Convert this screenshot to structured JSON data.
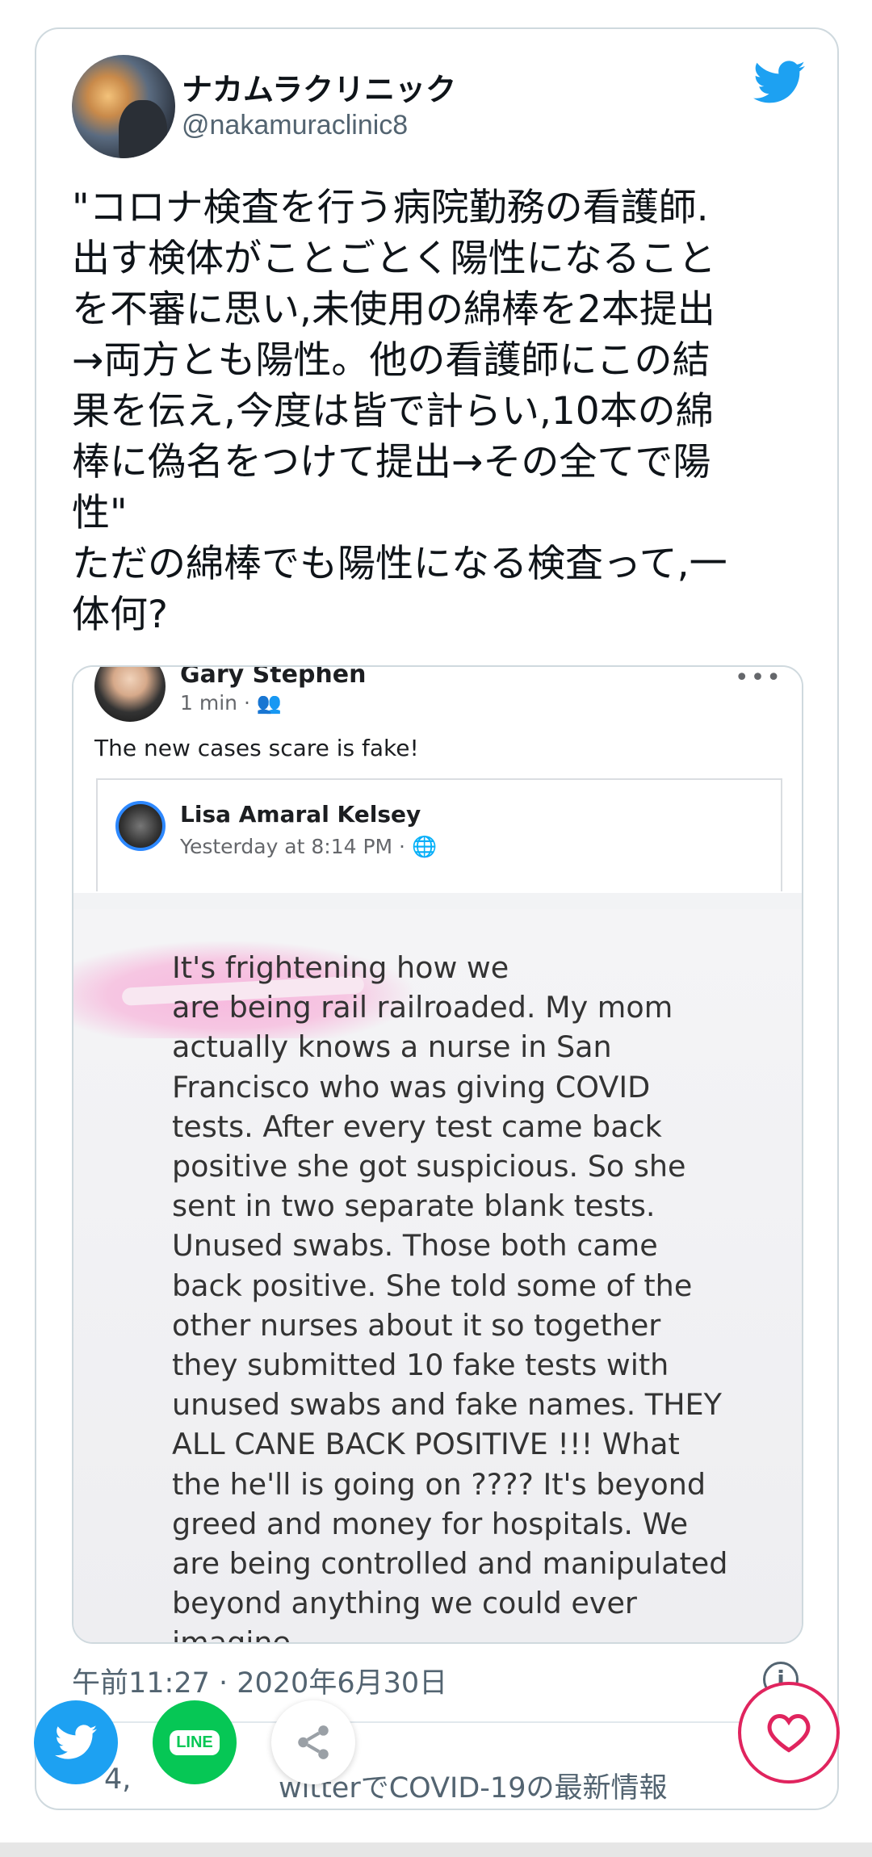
{
  "tweet": {
    "author_name": "ナカムラクリニック",
    "author_handle": "@nakamuraclinic8",
    "text": "\"コロナ検査を行う病院勤務の看護師.\n出す検体がことごとく陽性になること\nを不審に思い,未使用の綿棒を2本提出\n→両方とも陽性。他の看護師にこの結\n果を伝え,今度は皆で計らい,10本の綿\n棒に偽名をつけて提出→その全てで陽\n性\"\nただの綿棒でも陽性になる検査って,一\n体何?",
    "timestamp": "午前11:27 · 2020年6月30日",
    "likes_partial": "4,",
    "promo_partial": "witterでCOVID-19の最新情報"
  },
  "embed": {
    "poster_name": "Gary Stephen",
    "poster_meta": "1 min ·",
    "post_text": "The new cases scare is fake!",
    "shared_name": "Lisa Amaral Kelsey",
    "shared_meta": "Yesterday at 8:14 PM ·",
    "screenshot_text": "It's frightening how we\nare being rail railroaded. My mom\nactually knows a nurse in San\nFrancisco who was giving COVID\ntests. After every test came back\npositive she got suspicious. So she\nsent in two separate blank tests.\nUnused swabs. Those both came\nback positive. She told some of the\nother nurses about it so together\nthey submitted 10 fake tests with\nunused swabs and fake names. THEY\nALL CANE BACK POSITIVE !!! What\nthe he'll is going on ???? It's beyond\ngreed and money for hospitals. We\nare being controlled and manipulated\nbeyond anything we could ever\nimagine"
  },
  "share": {
    "line_label": "LINE"
  },
  "colors": {
    "twitter_blue": "#1da1f2",
    "line_green": "#06c755",
    "like_red": "#e0245e"
  }
}
